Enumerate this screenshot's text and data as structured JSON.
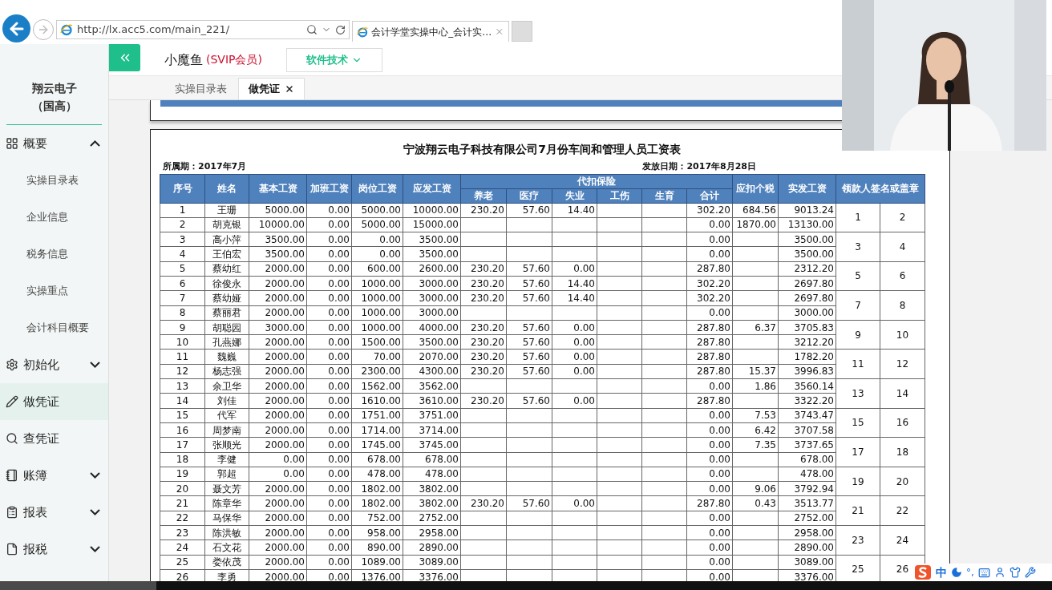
{
  "browser": {
    "url": "http://lx.acc5.com/main_221/",
    "tabs": [
      {
        "title": "会计学堂实操中心_会计实…",
        "selected": true
      }
    ]
  },
  "sidebar": {
    "company": "翔云电子（国高）",
    "items": [
      {
        "label": "概要",
        "expanded": true,
        "selected": false,
        "children": [
          {
            "label": "实操目录表"
          },
          {
            "label": "企业信息"
          },
          {
            "label": "税务信息"
          },
          {
            "label": "实操重点"
          },
          {
            "label": "会计科目概要"
          }
        ]
      },
      {
        "label": "初始化",
        "expanded": false,
        "selected": false
      },
      {
        "label": "做凭证",
        "selected": true
      },
      {
        "label": "查凭证",
        "selected": false
      },
      {
        "label": "账簿",
        "expanded": false,
        "selected": false
      },
      {
        "label": "报表",
        "expanded": false,
        "selected": false
      },
      {
        "label": "报税",
        "expanded": false,
        "selected": false
      }
    ]
  },
  "header": {
    "user": "小魔鱼",
    "badge": "(SVIP会员)",
    "menu": "软件技术"
  },
  "page_tabs": [
    {
      "label": "实操目录表",
      "selected": false,
      "closable": false
    },
    {
      "label": "做凭证",
      "selected": true,
      "closable": true
    }
  ],
  "sheet": {
    "title": "宁波翔云电子科技有限公司7月份车间和管理人员工资表",
    "period": "所属期：2017年7月",
    "pay_date": "发放日期：2017年8月28日",
    "columns": [
      {
        "label": "序号"
      },
      {
        "label": "姓名"
      },
      {
        "label": "基本工资"
      },
      {
        "label": "加班工资"
      },
      {
        "label": "岗位工资"
      },
      {
        "label": "应发工资"
      },
      {
        "label": "代扣保险",
        "children": [
          {
            "label": "养老"
          },
          {
            "label": "医疗"
          },
          {
            "label": "失业"
          },
          {
            "label": "工伤"
          },
          {
            "label": "生育"
          },
          {
            "label": "合计"
          }
        ]
      },
      {
        "label": "应扣个税"
      },
      {
        "label": "实发工资"
      },
      {
        "label": "领款人签名或盖章"
      }
    ],
    "rows": [
      {
        "no": "1",
        "name": "王珊",
        "base": "5000.00",
        "overtime": "0.00",
        "post": "5000.00",
        "gross": "10000.00",
        "pension": "230.20",
        "medical": "57.60",
        "unemployment": "14.40",
        "total": "302.20",
        "tax": "684.56",
        "net": "9013.24"
      },
      {
        "no": "2",
        "name": "胡克银",
        "base": "10000.00",
        "overtime": "0.00",
        "post": "5000.00",
        "gross": "15000.00",
        "total": "0.00",
        "tax": "1870.00",
        "net": "13130.00"
      },
      {
        "no": "3",
        "name": "高小萍",
        "base": "3500.00",
        "overtime": "0.00",
        "post": "0.00",
        "gross": "3500.00",
        "total": "0.00",
        "net": "3500.00"
      },
      {
        "no": "4",
        "name": "王伯宏",
        "base": "3500.00",
        "overtime": "0.00",
        "post": "0.00",
        "gross": "3500.00",
        "total": "0.00",
        "net": "3500.00"
      },
      {
        "no": "5",
        "name": "蔡幼红",
        "base": "2000.00",
        "overtime": "0.00",
        "post": "600.00",
        "gross": "2600.00",
        "pension": "230.20",
        "medical": "57.60",
        "unemployment": "0.00",
        "total": "287.80",
        "net": "2312.20"
      },
      {
        "no": "6",
        "name": "徐俊永",
        "base": "2000.00",
        "overtime": "0.00",
        "post": "1000.00",
        "gross": "3000.00",
        "pension": "230.20",
        "medical": "57.60",
        "unemployment": "14.40",
        "total": "302.20",
        "net": "2697.80"
      },
      {
        "no": "7",
        "name": "蔡幼娅",
        "base": "2000.00",
        "overtime": "0.00",
        "post": "1000.00",
        "gross": "3000.00",
        "pension": "230.20",
        "medical": "57.60",
        "unemployment": "14.40",
        "total": "302.20",
        "net": "2697.80"
      },
      {
        "no": "8",
        "name": "蔡丽君",
        "base": "2000.00",
        "overtime": "0.00",
        "post": "1000.00",
        "gross": "3000.00",
        "total": "0.00",
        "net": "3000.00"
      },
      {
        "no": "9",
        "name": "胡聪园",
        "base": "3000.00",
        "overtime": "0.00",
        "post": "1000.00",
        "gross": "4000.00",
        "pension": "230.20",
        "medical": "57.60",
        "unemployment": "0.00",
        "total": "287.80",
        "tax": "6.37",
        "net": "3705.83"
      },
      {
        "no": "10",
        "name": "孔燕娜",
        "base": "2000.00",
        "overtime": "0.00",
        "post": "1500.00",
        "gross": "3500.00",
        "pension": "230.20",
        "medical": "57.60",
        "unemployment": "0.00",
        "total": "287.80",
        "net": "3212.20"
      },
      {
        "no": "11",
        "name": "魏巍",
        "base": "2000.00",
        "overtime": "0.00",
        "post": "70.00",
        "gross": "2070.00",
        "pension": "230.20",
        "medical": "57.60",
        "unemployment": "0.00",
        "total": "287.80",
        "net": "1782.20"
      },
      {
        "no": "12",
        "name": "杨志强",
        "base": "2000.00",
        "overtime": "0.00",
        "post": "2300.00",
        "gross": "4300.00",
        "pension": "230.20",
        "medical": "57.60",
        "unemployment": "0.00",
        "total": "287.80",
        "tax": "15.37",
        "net": "3996.83"
      },
      {
        "no": "13",
        "name": "余卫华",
        "base": "2000.00",
        "overtime": "0.00",
        "post": "1562.00",
        "gross": "3562.00",
        "total": "0.00",
        "tax": "1.86",
        "net": "3560.14"
      },
      {
        "no": "14",
        "name": "刘佳",
        "base": "2000.00",
        "overtime": "0.00",
        "post": "1610.00",
        "gross": "3610.00",
        "pension": "230.20",
        "medical": "57.60",
        "unemployment": "0.00",
        "total": "287.80",
        "net": "3322.20"
      },
      {
        "no": "15",
        "name": "代军",
        "base": "2000.00",
        "overtime": "0.00",
        "post": "1751.00",
        "gross": "3751.00",
        "total": "0.00",
        "tax": "7.53",
        "net": "3743.47"
      },
      {
        "no": "16",
        "name": "周梦南",
        "base": "2000.00",
        "overtime": "0.00",
        "post": "1714.00",
        "gross": "3714.00",
        "total": "0.00",
        "tax": "6.42",
        "net": "3707.58"
      },
      {
        "no": "17",
        "name": "张顺光",
        "base": "2000.00",
        "overtime": "0.00",
        "post": "1745.00",
        "gross": "3745.00",
        "total": "0.00",
        "tax": "7.35",
        "net": "3737.65"
      },
      {
        "no": "18",
        "name": "李健",
        "base": "0.00",
        "overtime": "0.00",
        "post": "678.00",
        "gross": "678.00",
        "total": "0.00",
        "net": "678.00"
      },
      {
        "no": "19",
        "name": "郭超",
        "base": "0.00",
        "overtime": "0.00",
        "post": "478.00",
        "gross": "478.00",
        "total": "0.00",
        "net": "478.00"
      },
      {
        "no": "20",
        "name": "聂文芳",
        "base": "2000.00",
        "overtime": "0.00",
        "post": "1802.00",
        "gross": "3802.00",
        "total": "0.00",
        "tax": "9.06",
        "net": "3792.94"
      },
      {
        "no": "21",
        "name": "陈章华",
        "base": "2000.00",
        "overtime": "0.00",
        "post": "1802.00",
        "gross": "3802.00",
        "pension": "230.20",
        "medical": "57.60",
        "unemployment": "0.00",
        "total": "287.80",
        "tax": "0.43",
        "net": "3513.77"
      },
      {
        "no": "22",
        "name": "马保华",
        "base": "2000.00",
        "overtime": "0.00",
        "post": "752.00",
        "gross": "2752.00",
        "total": "0.00",
        "net": "2752.00"
      },
      {
        "no": "23",
        "name": "陈洪敏",
        "base": "2000.00",
        "overtime": "0.00",
        "post": "958.00",
        "gross": "2958.00",
        "total": "0.00",
        "net": "2958.00"
      },
      {
        "no": "24",
        "name": "石文花",
        "base": "2000.00",
        "overtime": "0.00",
        "post": "890.00",
        "gross": "2890.00",
        "total": "0.00",
        "net": "2890.00"
      },
      {
        "no": "25",
        "name": "娄依茂",
        "base": "2000.00",
        "overtime": "0.00",
        "post": "1089.00",
        "gross": "3089.00",
        "total": "0.00",
        "net": "3089.00"
      },
      {
        "no": "26",
        "name": "李勇",
        "base": "2000.00",
        "overtime": "0.00",
        "post": "1376.00",
        "gross": "3376.00",
        "total": "0.00",
        "net": "3376.00"
      }
    ],
    "signature_pairs": [
      [
        "1",
        "2"
      ],
      [
        "3",
        "4"
      ],
      [
        "5",
        "6"
      ],
      [
        "7",
        "8"
      ],
      [
        "9",
        "10"
      ],
      [
        "11",
        "12"
      ],
      [
        "13",
        "14"
      ],
      [
        "15",
        "16"
      ],
      [
        "17",
        "18"
      ],
      [
        "19",
        "20"
      ],
      [
        "21",
        "22"
      ],
      [
        "23",
        "24"
      ],
      [
        "25",
        "26"
      ]
    ]
  },
  "ime": {
    "mode": "中",
    "punct": "°,"
  }
}
